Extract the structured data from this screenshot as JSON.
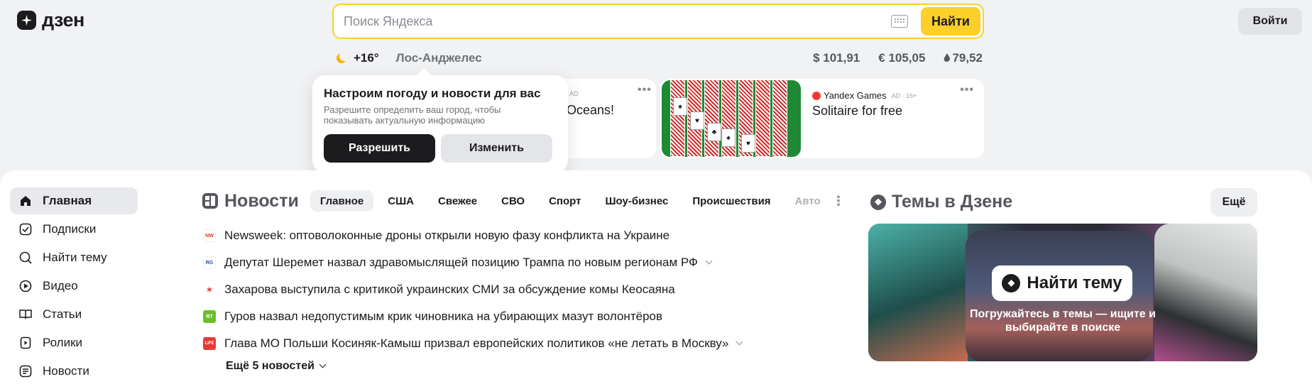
{
  "logo": {
    "text": "дзен"
  },
  "search": {
    "placeholder": "Поиск Яндекса",
    "button_label": "Найти"
  },
  "header": {
    "login_label": "Войти"
  },
  "weather": {
    "temperature": "+16°",
    "city": "Лос-Анджелес"
  },
  "rates": {
    "usd": "$ 101,91",
    "eur": "€ 105,05",
    "oil": "79,52"
  },
  "ads": [
    {
      "badge": "AD",
      "title": "Oceans!"
    },
    {
      "brand": "Yandex Games",
      "meta": "AD · 16+",
      "title": "Solitaire for free"
    }
  ],
  "popup": {
    "title": "Настроим погоду и новости для вас",
    "text": "Разрешите определить ваш город, чтобы показывать актуальную информацию",
    "allow_label": "Разрешить",
    "change_label": "Изменить"
  },
  "sidebar": {
    "items": [
      {
        "label": "Главная",
        "icon": "home-icon"
      },
      {
        "label": "Подписки",
        "icon": "subscriptions-icon"
      },
      {
        "label": "Найти тему",
        "icon": "find-topic-icon"
      },
      {
        "label": "Видео",
        "icon": "video-icon"
      },
      {
        "label": "Статьи",
        "icon": "articles-icon"
      },
      {
        "label": "Ролики",
        "icon": "shorts-icon"
      },
      {
        "label": "Новости",
        "icon": "news-icon"
      }
    ]
  },
  "news": {
    "title": "Новости",
    "tabs": [
      "Главное",
      "США",
      "Свежее",
      "СВО",
      "Спорт",
      "Шоу-бизнес",
      "Происшествия",
      "Авто"
    ],
    "items": [
      {
        "source": "NW",
        "source_color": "#ffffff",
        "text": "Newsweek: оптоволоконные дроны открыли новую фазу конфликта на Украине"
      },
      {
        "source": "RG",
        "source_color": "#ffffff",
        "text": "Депутат Шеремет назвал здравомыслящей позицию Трампа по новым регионам РФ"
      },
      {
        "source": "",
        "source_color": "#ffffff",
        "text": "Захарова выступила с критикой украинских СМИ за обсуждение комы Кеосаяна"
      },
      {
        "source": "RT",
        "source_color": "#6cbf2a",
        "text": "Гуров назвал недопустимым крик чиновника на убирающих мазут волонтёров"
      },
      {
        "source": "LIFE",
        "source_color": "#e53935",
        "text": "Глава МО Польши Косиняк-Камыш призвал европейских политиков «не летать в Москву»"
      }
    ],
    "more_label": "Ещё 5 новостей"
  },
  "topics": {
    "title": "Темы в Дзене",
    "more_label": "Ещё",
    "banner_button": "Найти тему",
    "banner_text": "Погружайтесь в темы — ищите и выбирайте в поиске"
  }
}
